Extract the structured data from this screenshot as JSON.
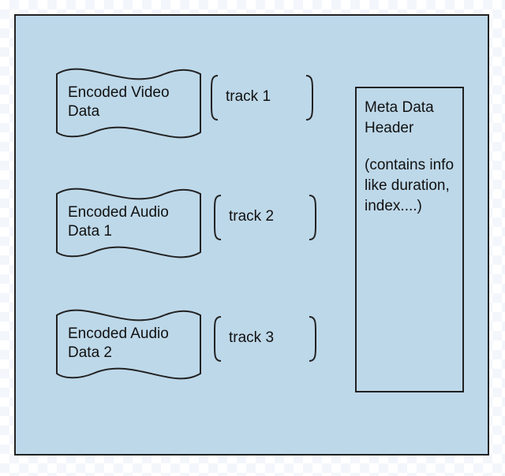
{
  "tracks": [
    {
      "flag_label": "Encoded Video Data",
      "track_label": "track 1"
    },
    {
      "flag_label": "Encoded Audio Data 1",
      "track_label": "track 2"
    },
    {
      "flag_label": "Encoded Audio Data 2",
      "track_label": "track 3"
    }
  ],
  "meta": {
    "title": "Meta Data Header",
    "body": "(contains info like duration, index....)"
  }
}
